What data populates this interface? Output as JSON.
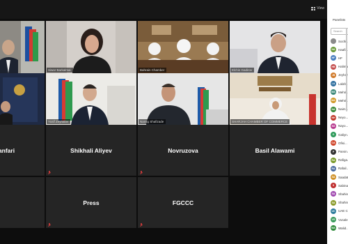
{
  "toolbar": {
    "view_label": "View"
  },
  "tiles": [
    {
      "label": ""
    },
    {
      "label": "Siwar Barkalmai"
    },
    {
      "label": "Bahrain Chamber"
    },
    {
      "label": "Elchin Gadirov"
    },
    {
      "bigname": "shanfari"
    },
    {
      "label": "Yusif Zeynalov"
    },
    {
      "label": "Namig Shafizade"
    },
    {
      "label": "SHARJAH CHAMBER OF COMMERCE"
    },
    {
      "bigname": "Shikhali Aliyev"
    },
    {
      "bigname": "Novruzova"
    },
    {
      "bigname": "Basil Alawami"
    },
    {
      "bigname": "Press"
    },
    {
      "bigname": "FGCCC"
    }
  ],
  "panel": {
    "tab_label": "Panelists",
    "search_placeholder": "Search",
    "participants": [
      {
        "initials": "",
        "name": "Sochi...",
        "color": "#8a8a8a"
      },
      {
        "initials": "HA",
        "name": "Haafiz...",
        "color": "#6a9a3a"
      },
      {
        "initials": "HF",
        "name": "HF",
        "color": "#4a7fc0"
      },
      {
        "initials": "HB",
        "name": "Halima...",
        "color": "#c44d4d"
      },
      {
        "initials": "JB",
        "name": "Jeyhan...",
        "color": "#d07a2a"
      },
      {
        "initials": "LA",
        "name": "Lalah...",
        "color": "#2f6f9f"
      },
      {
        "initials": "MA",
        "name": "Mehri...",
        "color": "#3e8a7a"
      },
      {
        "initials": "MA",
        "name": "Mehri...",
        "color": "#d19a2a"
      },
      {
        "initials": "NA",
        "name": "Naim...",
        "color": "#3a8a3a"
      },
      {
        "initials": "NH",
        "name": "Neyo...",
        "color": "#c0392b"
      },
      {
        "initials": "NS",
        "name": "Nayo...",
        "color": "#b83b8f"
      },
      {
        "initials": "O",
        "name": "Galiyn...",
        "color": "#2e9a5a"
      },
      {
        "initials": "OA",
        "name": "Ofisi...",
        "color": "#d0452a"
      },
      {
        "initials": "P",
        "name": "Parvin...",
        "color": "#333333"
      },
      {
        "initials": "RA",
        "name": "Rafiga...",
        "color": "#7a9a2a"
      },
      {
        "initials": "RA",
        "name": "Rafail...",
        "color": "#4a6aa0"
      },
      {
        "initials": "SA",
        "name": "Saadat...",
        "color": "#d0922a"
      },
      {
        "initials": "S",
        "name": "Sabina...",
        "color": "#c03030"
      },
      {
        "initials": "SA",
        "name": "Shahin...",
        "color": "#a04ab0"
      },
      {
        "initials": "SA",
        "name": "Shahin...",
        "color": "#8a9a2a"
      },
      {
        "initials": "UC",
        "name": "UAE C...",
        "color": "#2a7a9a"
      },
      {
        "initials": "VG",
        "name": "Vusale...",
        "color": "#3a9a5a"
      },
      {
        "initials": "WA",
        "name": "Walid...",
        "color": "#2e8a3a"
      }
    ]
  }
}
